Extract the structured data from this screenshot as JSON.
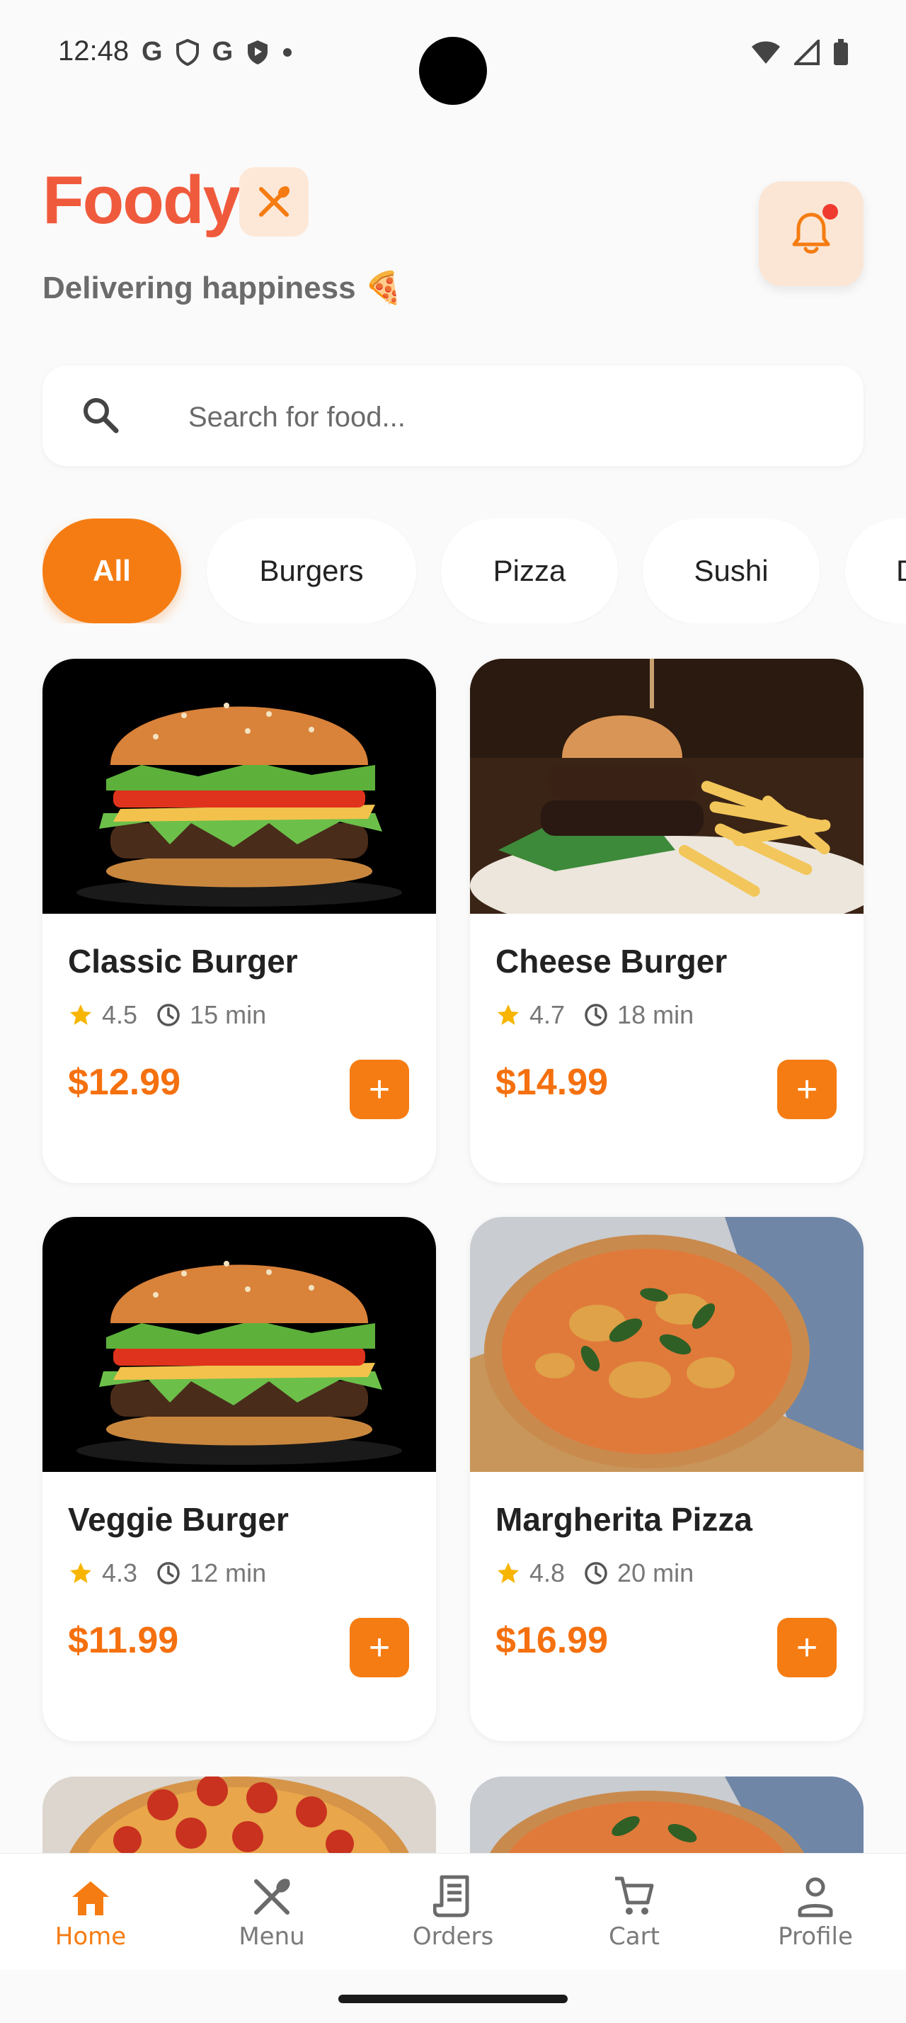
{
  "status_bar": {
    "time": "12:48",
    "left_icons": [
      "G",
      "shield-icon",
      "G",
      "play-shield-icon",
      "dot-icon"
    ],
    "right_icons": [
      "wifi-icon",
      "signal-icon",
      "battery-icon"
    ]
  },
  "header": {
    "brand": "Foody",
    "brand_badge_icon": "utensils-icon",
    "tagline": "Delivering happiness 🍕",
    "notification_icon": "bell-icon"
  },
  "search": {
    "placeholder": "Search for food...",
    "value": ""
  },
  "categories": [
    {
      "label": "All",
      "active": true
    },
    {
      "label": "Burgers",
      "active": false
    },
    {
      "label": "Pizza",
      "active": false
    },
    {
      "label": "Sushi",
      "active": false
    },
    {
      "label": "D",
      "active": false
    }
  ],
  "items": [
    {
      "name": "Classic Burger",
      "rating": "4.5",
      "time": "15 min",
      "price": "$12.99",
      "image": "burger-black-bg"
    },
    {
      "name": "Cheese Burger",
      "rating": "4.7",
      "time": "18 min",
      "price": "$14.99",
      "image": "burger-with-fries"
    },
    {
      "name": "Veggie Burger",
      "rating": "4.3",
      "time": "12 min",
      "price": "$11.99",
      "image": "burger-black-bg"
    },
    {
      "name": "Margherita Pizza",
      "rating": "4.8",
      "time": "20 min",
      "price": "$16.99",
      "image": "pizza-basil"
    }
  ],
  "bottom_nav": [
    {
      "label": "Home",
      "icon": "home-icon",
      "active": true
    },
    {
      "label": "Menu",
      "icon": "utensils-icon",
      "active": false
    },
    {
      "label": "Orders",
      "icon": "receipt-icon",
      "active": false
    },
    {
      "label": "Cart",
      "icon": "cart-icon",
      "active": false
    },
    {
      "label": "Profile",
      "icon": "person-icon",
      "active": false
    }
  ],
  "colors": {
    "accent": "#f57c12",
    "brand": "#f05a3c",
    "star": "#f7b500"
  }
}
